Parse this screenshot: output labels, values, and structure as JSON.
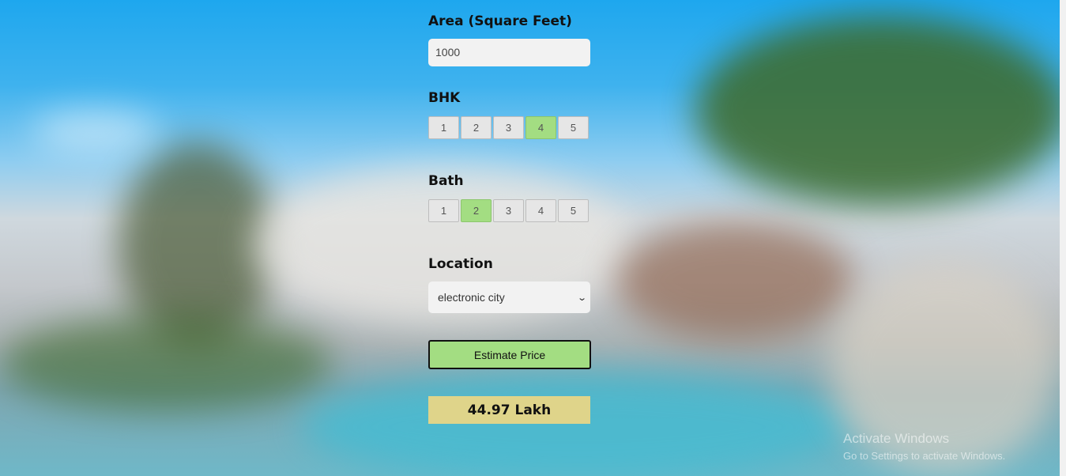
{
  "form": {
    "area": {
      "label": "Area (Square Feet)",
      "value": "1000"
    },
    "bhk": {
      "label": "BHK",
      "options": [
        "1",
        "2",
        "3",
        "4",
        "5"
      ],
      "selected": "4"
    },
    "bath": {
      "label": "Bath",
      "options": [
        "1",
        "2",
        "3",
        "4",
        "5"
      ],
      "selected": "2"
    },
    "location": {
      "label": "Location",
      "selected": "electronic city"
    },
    "estimate_button": "Estimate Price",
    "result": "44.97 Lakh"
  },
  "watermark": {
    "line1": "Activate Windows",
    "line2": "Go to Settings to activate Windows."
  },
  "colors": {
    "selected_option": "#a3dd82",
    "result_bg": "#dfd48a",
    "input_bg": "#f2f2f2"
  }
}
